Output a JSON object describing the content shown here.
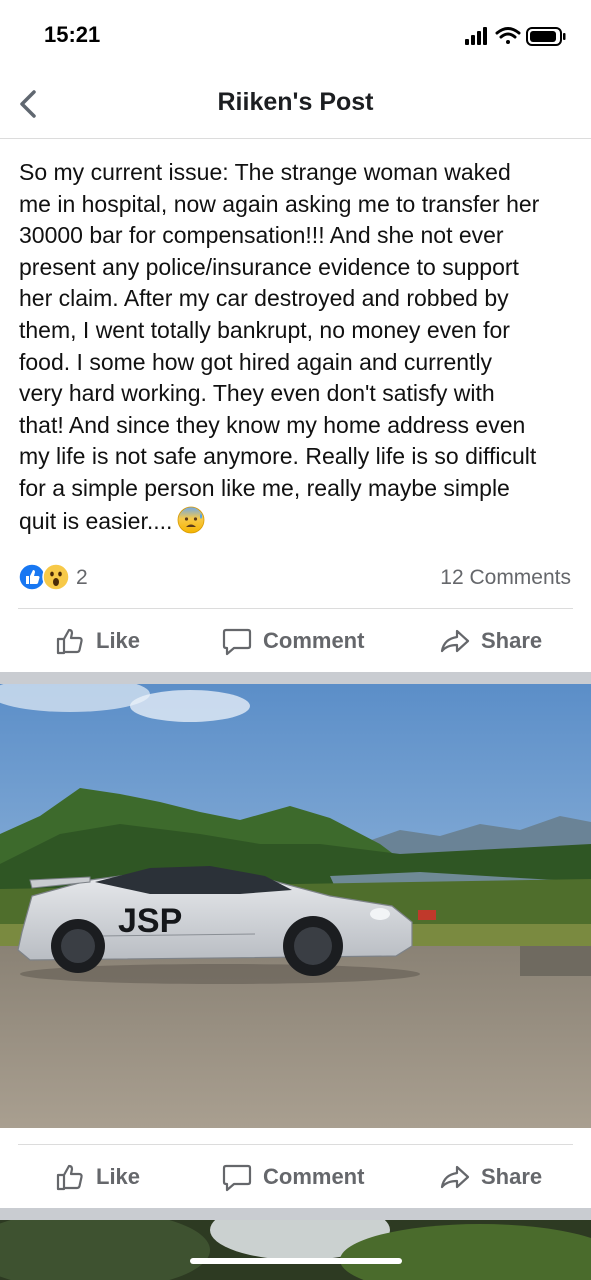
{
  "status_bar": {
    "time": "15:21"
  },
  "nav": {
    "title": "Riiken's Post"
  },
  "post": {
    "text": "So my current issue: The strange woman waked\nme in hospital, now again asking me to transfer her\n30000 bar for compensation!!! And she not ever\npresent any police/insurance evidence to support\nher claim. After my car destroyed and robbed by\nthem, I went totally bankrupt,  no money even for\nfood.  I some how got hired again and currently\nvery hard working.  They even don't satisfy with\nthat!  And since they know my home address even\nmy life is not safe anymore. Really life is so difficult\nfor a simple person like me,  really maybe simple\nquit is easier....",
    "end_emoji": "anxious-face-with-sweat-icon",
    "reaction_count": "2",
    "reactions": [
      "like-reaction-icon",
      "wow-reaction-icon"
    ],
    "comments_label": "12 Comments"
  },
  "actions": {
    "like": "Like",
    "comment": "Comment",
    "share": "Share"
  },
  "photo": {
    "plate_text": "JSP",
    "subject": "silver sports car parked by a lake with green hills"
  },
  "colors": {
    "accent": "#1877f2",
    "muted": "#65676b",
    "separator": "#c9ccd1"
  }
}
